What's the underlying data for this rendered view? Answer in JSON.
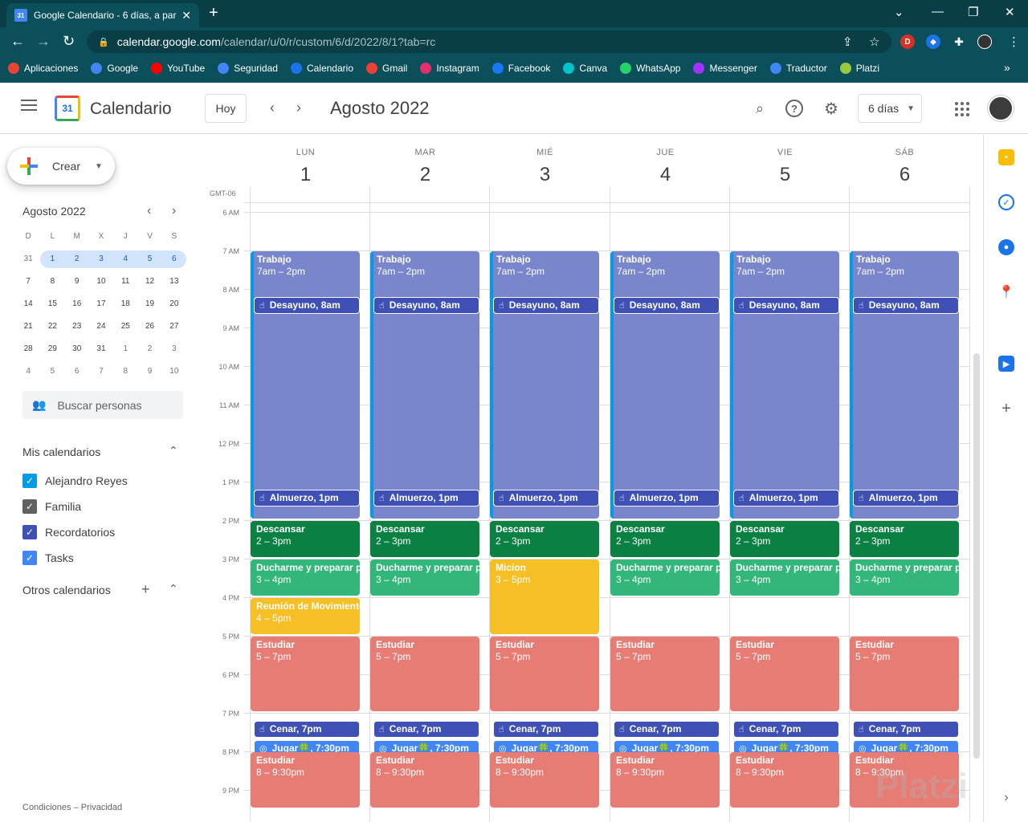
{
  "browser": {
    "tab_title": "Google Calendario - 6 días, a par",
    "url_host": "calendar.google.com",
    "url_path": "/calendar/u/0/r/custom/6/d/2022/8/1?tab=rc",
    "bookmarks": [
      {
        "label": "Aplicaciones",
        "color": "#ea4335"
      },
      {
        "label": "Google",
        "color": "#4285f4"
      },
      {
        "label": "YouTube",
        "color": "#ff0000"
      },
      {
        "label": "Seguridad",
        "color": "#4285f4"
      },
      {
        "label": "Calendario",
        "color": "#1a73e8"
      },
      {
        "label": "Gmail",
        "color": "#ea4335"
      },
      {
        "label": "Instagram",
        "color": "#e1306c"
      },
      {
        "label": "Facebook",
        "color": "#1877f2"
      },
      {
        "label": "Canva",
        "color": "#00c4cc"
      },
      {
        "label": "WhatsApp",
        "color": "#25d366"
      },
      {
        "label": "Messenger",
        "color": "#a033ff"
      },
      {
        "label": "Traductor",
        "color": "#4285f4"
      },
      {
        "label": "Platzi",
        "color": "#98ca3f"
      }
    ]
  },
  "header": {
    "app_name": "Calendario",
    "logo_day": "31",
    "today_button": "Hoy",
    "title": "Agosto 2022",
    "view": "6 días"
  },
  "sidebar": {
    "create_label": "Crear",
    "mini_title": "Agosto 2022",
    "day_initials": [
      "D",
      "L",
      "M",
      "X",
      "J",
      "V",
      "S"
    ],
    "weeks": [
      [
        "31",
        "1",
        "2",
        "3",
        "4",
        "5",
        "6"
      ],
      [
        "7",
        "8",
        "9",
        "10",
        "11",
        "12",
        "13"
      ],
      [
        "14",
        "15",
        "16",
        "17",
        "18",
        "19",
        "20"
      ],
      [
        "21",
        "22",
        "23",
        "24",
        "25",
        "26",
        "27"
      ],
      [
        "28",
        "29",
        "30",
        "31",
        "1",
        "2",
        "3"
      ],
      [
        "4",
        "5",
        "6",
        "7",
        "8",
        "9",
        "10"
      ]
    ],
    "search_people": "Buscar personas",
    "my_calendars_title": "Mis calendarios",
    "my_calendars": [
      {
        "label": "Alejandro Reyes",
        "color": "#039be5"
      },
      {
        "label": "Familia",
        "color": "#616161"
      },
      {
        "label": "Recordatorios",
        "color": "#3f51b5"
      },
      {
        "label": "Tasks",
        "color": "#4285f4"
      }
    ],
    "other_calendars_title": "Otros calendarios",
    "footer": "Condiciones – Privacidad"
  },
  "grid": {
    "timezone": "GMT-06",
    "days": [
      {
        "name": "LUN",
        "num": "1"
      },
      {
        "name": "MAR",
        "num": "2"
      },
      {
        "name": "MIÉ",
        "num": "3"
      },
      {
        "name": "JUE",
        "num": "4"
      },
      {
        "name": "VIE",
        "num": "5"
      },
      {
        "name": "SÁB",
        "num": "6"
      }
    ],
    "hours": [
      "6 AM",
      "7 AM",
      "8 AM",
      "9 AM",
      "10 AM",
      "11 AM",
      "12 PM",
      "1 PM",
      "2 PM",
      "3 PM",
      "4 PM",
      "5 PM",
      "6 PM",
      "7 PM",
      "8 PM",
      "9 PM"
    ]
  },
  "events": {
    "trabajo": {
      "title": "Trabajo",
      "time": "7am – 2pm",
      "color": "#7986cb"
    },
    "desayuno": "Desayuno, 8am",
    "almuerzo": "Almuerzo, 1pm",
    "descansar": {
      "title": "Descansar",
      "time": "2 – 3pm",
      "color": "#0b8043"
    },
    "ducharme": {
      "title": "Ducharme y preparar pa",
      "time": "3 – 4pm",
      "color": "#33b679"
    },
    "reunion": {
      "title": "Reunión de Movimiento",
      "time": "4 – 5pm",
      "color": "#f6bf26"
    },
    "micion": {
      "title": "Micion",
      "time": "3 – 5pm",
      "color": "#f6bf26"
    },
    "estudiar1": {
      "title": "Estudiar",
      "time": "5 – 7pm",
      "color": "#e67c73"
    },
    "cenar": "Cenar, 7pm",
    "jugar": "Jugar🍀, 7:30pm",
    "estudiar2": {
      "title": "Estudiar",
      "time": "8 – 9:30pm",
      "color": "#e67c73"
    },
    "chip_color": "#3f51b5",
    "task_color": "#4285f4"
  },
  "watermark": "Platzi"
}
